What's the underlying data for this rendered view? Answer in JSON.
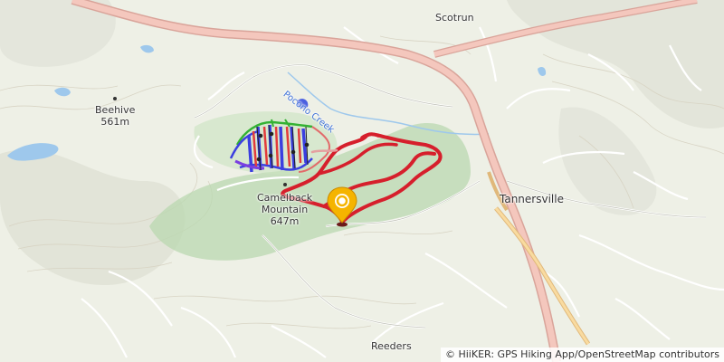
{
  "places": {
    "scotrun": "Scotrun",
    "tannersville": "Tannersville",
    "reeders": "Reeders",
    "creek": "Pocono Creek"
  },
  "peaks": {
    "beehive": {
      "name": "Beehive",
      "elevation": "561m"
    },
    "camelback": {
      "name": "Camelback",
      "name2": "Mountain",
      "elevation": "647m"
    }
  },
  "attribution": {
    "symbol": "©",
    "app": "HiiKER: GPS Hiking App",
    "separator": "/",
    "osm": "OpenStreetMap contributors"
  },
  "colors": {
    "trail": "#d61f2c",
    "trailhead_marker": "#f5b400",
    "ski_blue": "#3b3fe0",
    "ski_red": "#e23b3b",
    "ski_green": "#34b233",
    "forest": "#b9d8b0",
    "highway": "#f0c2b8",
    "water": "#9ec8ec"
  },
  "icons": {
    "trailhead": "trailhead-pin-icon",
    "peak": "peak-dot-icon"
  }
}
